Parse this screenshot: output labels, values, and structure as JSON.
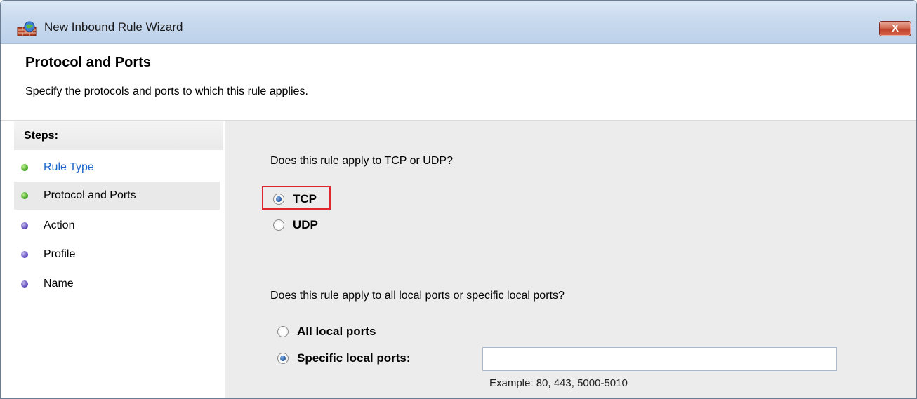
{
  "window": {
    "title": "New Inbound Rule Wizard",
    "close_label": "X"
  },
  "header": {
    "title": "Protocol and Ports",
    "subtitle": "Specify the protocols and ports to which this rule applies."
  },
  "steps": {
    "heading": "Steps:",
    "items": [
      {
        "label": "Rule Type",
        "status": "done",
        "style": "link",
        "dot_color": "#3c9a1d"
      },
      {
        "label": "Protocol and Ports",
        "status": "current",
        "style": "active",
        "dot_color": "#3c9a1d"
      },
      {
        "label": "Action",
        "status": "pending",
        "style": "normal",
        "dot_color": "#5642b5"
      },
      {
        "label": "Profile",
        "status": "pending",
        "style": "normal",
        "dot_color": "#5642b5"
      },
      {
        "label": "Name",
        "status": "pending",
        "style": "normal",
        "dot_color": "#5642b5"
      }
    ]
  },
  "protocol": {
    "question": "Does this rule apply to TCP or UDP?",
    "options": [
      {
        "label": "TCP",
        "selected": true
      },
      {
        "label": "UDP",
        "selected": false
      }
    ],
    "highlight_color": "#e2262f"
  },
  "ports": {
    "question": "Does this rule apply to all local ports or specific local ports?",
    "options": [
      {
        "label": "All local ports",
        "selected": false
      },
      {
        "label": "Specific local ports:",
        "selected": true
      }
    ],
    "input_value": "",
    "example": "Example: 80, 443, 5000-5010"
  }
}
